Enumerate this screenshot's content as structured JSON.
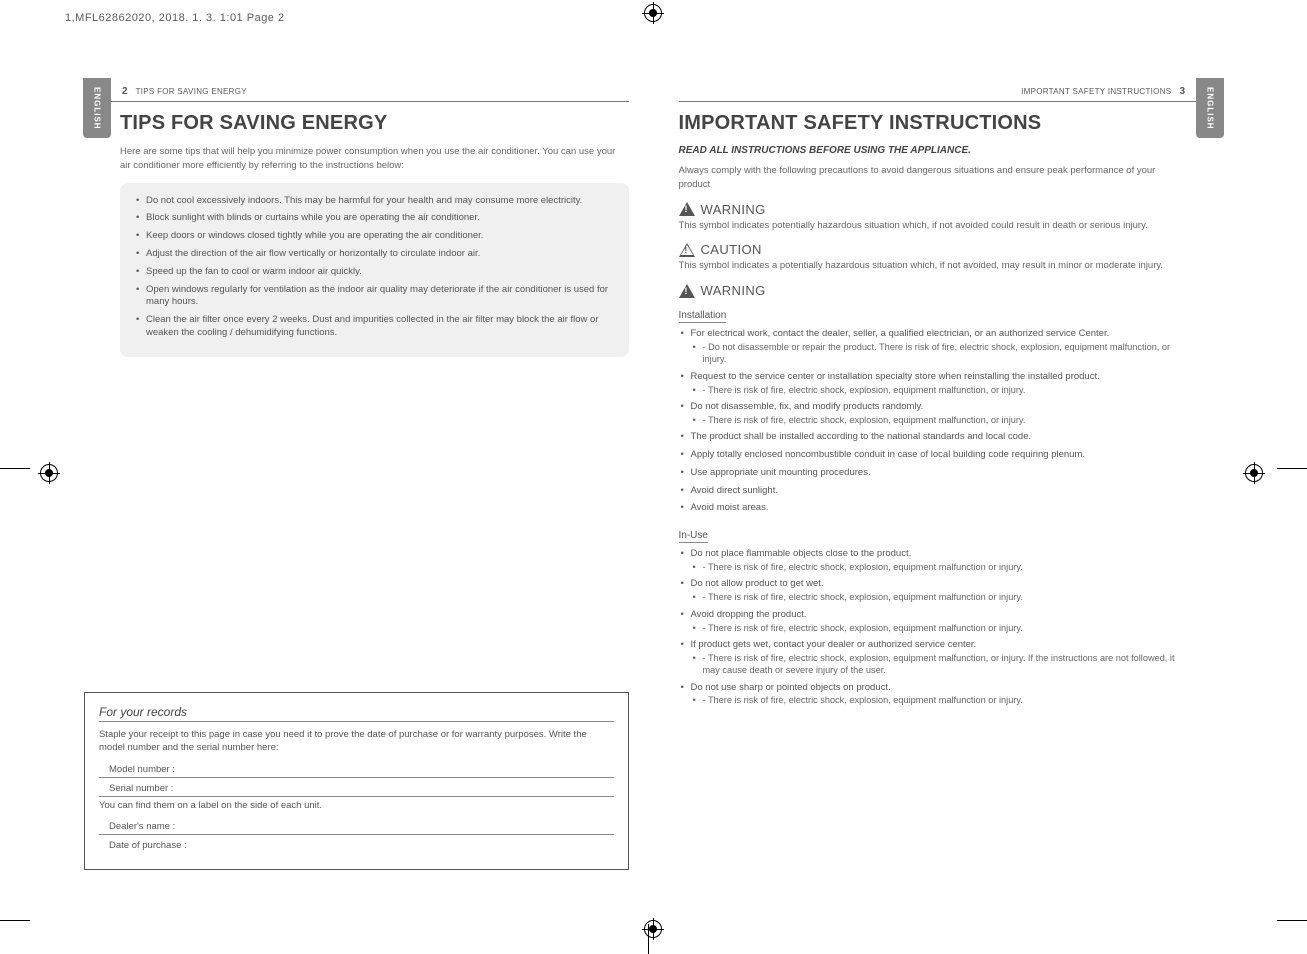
{
  "print": {
    "header": "1,MFL62862020,    2018. 1. 3.    1:01  Page 2",
    "lang_tab": "ENGLISH"
  },
  "left": {
    "page_num": "2",
    "running": "TIPS FOR SAVING ENERGY",
    "title": "TIPS FOR SAVING ENERGY",
    "intro": "Here are some tips that will help you minimize power consumption when you use the air conditioner. You can use your air conditioner more efficiently by referring to the instructions below:",
    "tips": [
      "Do not cool excessively indoors. This may be harmful for your health and may consume more electricity.",
      "Block sunlight with blinds or curtains while you are operating the air conditioner.",
      "Keep doors or windows closed tightly while you are operating the air conditioner.",
      "Adjust the direction of the air flow vertically or horizontally to circulate indoor air.",
      "Speed up the fan to cool or warm indoor air quickly.",
      "Open windows regularly for ventilation as the indoor air quality may deteriorate if the air conditioner is used for many hours.",
      "Clean the air filter once every 2 weeks. Dust and impurities collected in the air filter may block the air flow or weaken the cooling / dehumidifying functions."
    ],
    "records": {
      "title": "For your records",
      "desc": "Staple your receipt to this page in case you need it to prove the date of purchase or for warranty purposes. Write the model number and the serial number here:",
      "model": "Model number :",
      "serial": "Serial number :",
      "find": "You can find them on a label on the side of each unit.",
      "dealer": "Dealer's name :",
      "date": "Date of purchase :"
    }
  },
  "right": {
    "page_num": "3",
    "running": "IMPORTANT SAFETY INSTRUCTIONS",
    "title": "IMPORTANT SAFETY INSTRUCTIONS",
    "subtitle": "READ ALL INSTRUCTIONS BEFORE USING THE APPLIANCE.",
    "intro": "Always comply with the following precautions to avoid dangerous situations and ensure peak performance of your product",
    "warning_label": "WARNING",
    "caution_label": "CAUTION",
    "warning_desc": "This symbol indicates potentially hazardous situation which, if not avoided could result in death or serious injury.",
    "caution_desc": "This symbol indicates a potentially hazardous situation which, if not avoided, may result in minor or moderate injury.",
    "install_head": "Installation",
    "install": [
      {
        "main": "For electrical work, contact the dealer, seller, a qualified electrician, or an authorized service Center.",
        "sub": "- Do not disassemble or repair the product. There is risk of fire, electric shock, explosion, equipment malfunction, or injury."
      },
      {
        "main": "Request to the service center or installation specialty store when reinstalling the installed product.",
        "sub": "- There is risk of fire, electric shock, explosion, equipment malfunction, or injury."
      },
      {
        "main": "Do not disassemble, fix, and modify products randomly.",
        "sub": "- There is risk of fire, electric shock, explosion, equipment malfunction, or injury."
      },
      {
        "main": "The product shall be installed according to the national standards and local code."
      },
      {
        "main": "Apply totally enclosed noncombustible conduit in case of local building code requiring plenum."
      },
      {
        "main": "Use appropriate unit mounting procedures."
      },
      {
        "main": "Avoid direct sunlight."
      },
      {
        "main": "Avoid moist areas."
      }
    ],
    "inuse_head": "In-Use",
    "inuse": [
      {
        "main": "Do not place flammable objects close to the product.",
        "sub": "- There is risk of fire, electric shock, explosion, equipment malfunction or injury."
      },
      {
        "main": "Do not allow product to get wet.",
        "sub": "- There is risk of fire, electric shock, explosion, equipment malfunction or injury."
      },
      {
        "main": "Avoid dropping the product.",
        "sub": "- There is risk of fire, electric shock, explosion, equipment malfunction or injury."
      },
      {
        "main": "If product gets wet, contact your dealer  or authorized service center.",
        "sub": "- There is risk of fire, electric shock, explosion, equipment malfunction, or injury. If the instructions are not followed, it may cause death or severe injury of the user."
      },
      {
        "main": "Do not use sharp or pointed objects on product.",
        "sub": "- There is risk of fire, electric shock, explosion, equipment malfunction or injury."
      }
    ]
  }
}
